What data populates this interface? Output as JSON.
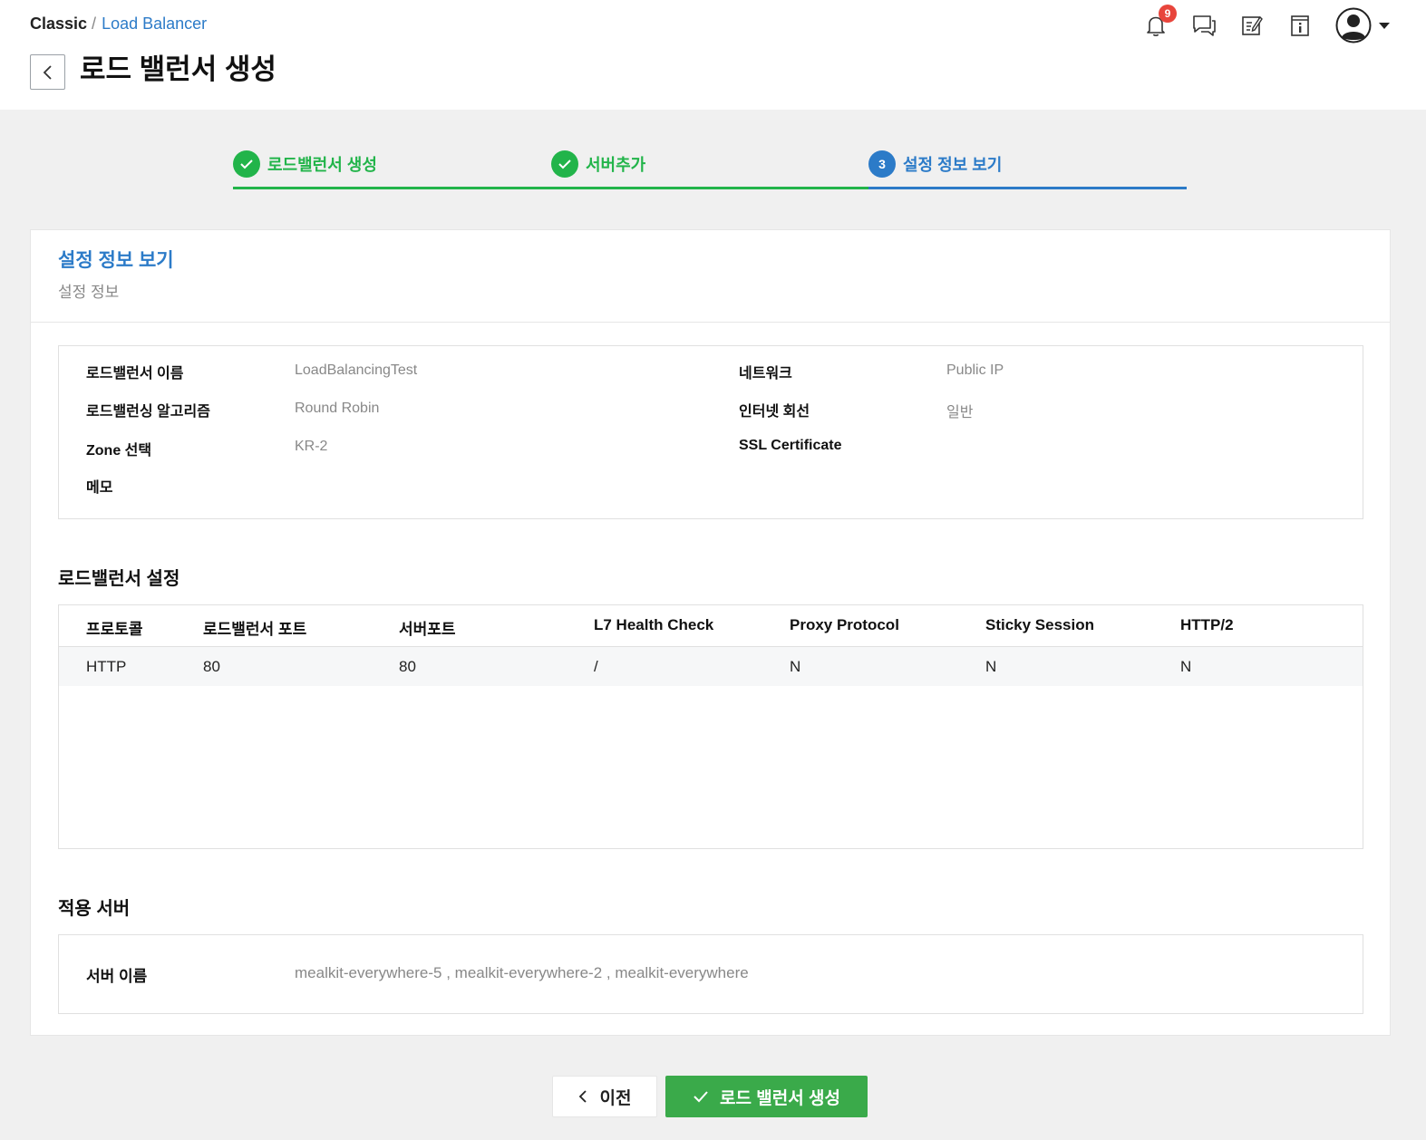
{
  "breadcrumb": {
    "root": "Classic",
    "separator": "/",
    "current": "Load Balancer"
  },
  "page_title": "로드 밸런서 생성",
  "notifications": {
    "count": "9"
  },
  "stepper": {
    "steps": [
      {
        "label": "로드밸런서 생성",
        "state": "done"
      },
      {
        "label": "서버추가",
        "state": "done"
      },
      {
        "number": "3",
        "label": "설정 정보 보기",
        "state": "current"
      }
    ]
  },
  "panel": {
    "title": "설정 정보 보기",
    "subtitle": "설정 정보"
  },
  "info": {
    "lb_name_label": "로드밸런서 이름",
    "lb_name_value": "LoadBalancingTest",
    "algorithm_label": "로드밸런싱 알고리즘",
    "algorithm_value": "Round Robin",
    "zone_label": "Zone 선택",
    "zone_value": "KR-2",
    "memo_label": "메모",
    "memo_value": "",
    "network_label": "네트워크",
    "network_value": "Public IP",
    "internet_label": "인터넷 회선",
    "internet_value": "일반",
    "ssl_label": "SSL Certificate",
    "ssl_value": ""
  },
  "lb_settings": {
    "title": "로드밸런서 설정",
    "columns": [
      "프로토콜",
      "로드밸런서 포트",
      "서버포트",
      "L7 Health Check",
      "Proxy Protocol",
      "Sticky Session",
      "HTTP/2"
    ],
    "rows": [
      [
        "HTTP",
        "80",
        "80",
        "/",
        "N",
        "N",
        "N"
      ]
    ]
  },
  "servers": {
    "title": "적용 서버",
    "label": "서버 이름",
    "value": "mealkit-everywhere-5 , mealkit-everywhere-2 , mealkit-everywhere"
  },
  "buttons": {
    "prev": "이전",
    "create": "로드 밸런서 생성"
  },
  "colors": {
    "accent": "#2c7bc8",
    "success": "#22b44a",
    "create_button": "#3aaa4a",
    "badge": "#e8453c"
  }
}
